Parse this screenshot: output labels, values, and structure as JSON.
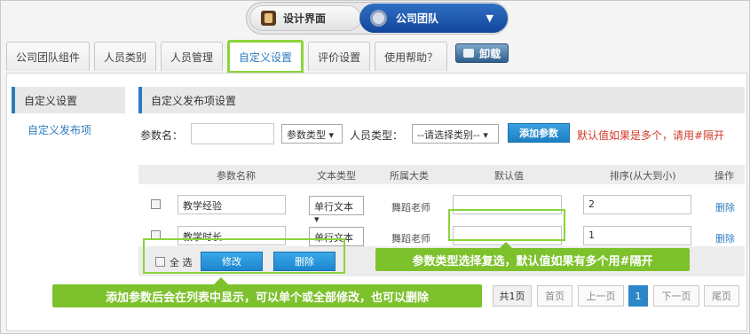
{
  "switch": {
    "left_label": "设计界面",
    "right_label": "公司团队",
    "caret": "▼"
  },
  "tabs": [
    {
      "label": "公司团队组件"
    },
    {
      "label": "人员类别"
    },
    {
      "label": "人员管理"
    },
    {
      "label": "自定义设置"
    },
    {
      "label": "评价设置"
    },
    {
      "label": "使用帮助？"
    }
  ],
  "unload_label": "卸载",
  "sidebar": {
    "title": "自定义设置",
    "item": "自定义发布项"
  },
  "main": {
    "title": "自定义发布项设置"
  },
  "filter": {
    "name_label": "参数名：",
    "type_select": "参数类型",
    "person_type_label": "人员类型：",
    "person_type_select": "--请选择类别--",
    "add_button": "添加参数",
    "hint": "默认值如果是多个，请用#隔开"
  },
  "table": {
    "headers": [
      "参数名称",
      "文本类型",
      "所属大类",
      "默认值",
      "排序(从大到小)",
      "操作"
    ],
    "rows": [
      {
        "name": "教学经验",
        "type": "单行文本",
        "category": "舞蹈老师",
        "default": "",
        "order": "2",
        "action": "删除"
      },
      {
        "name": "教学时长",
        "type": "单行文本",
        "category": "舞蹈老师",
        "default": "",
        "order": "1",
        "action": "删除"
      }
    ]
  },
  "bulk": {
    "select_all": "全 选",
    "edit": "修改",
    "delete": "删除"
  },
  "pagination": {
    "total": "共1页",
    "first": "首页",
    "prev": "上一页",
    "current": "1",
    "next": "下一页",
    "last": "尾页"
  },
  "callouts": {
    "param_type": "参数类型选择复选，默认值如果有多个用#隔开",
    "bulk_note": "添加参数后会在列表中显示，可以单个或全部修改，也可以删除"
  },
  "colors": {
    "accent_blue": "#2d7cc1",
    "highlight_green": "#8ad43a",
    "hint_red": "#d13a2a"
  }
}
